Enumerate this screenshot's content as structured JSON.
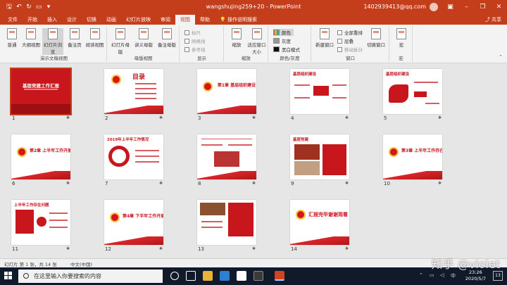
{
  "titlebar": {
    "autosave_icon": "autosave-icon",
    "document_title": "wangshujing259+20 - PowerPoint",
    "user": "1402939413@qq.com",
    "win_minimize": "–",
    "win_restore": "❐",
    "win_close": "✕"
  },
  "tabs": [
    "文件",
    "开始",
    "插入",
    "设计",
    "切换",
    "动画",
    "幻灯片放映",
    "审阅",
    "视图",
    "帮助",
    "操作说明搜索"
  ],
  "active_tab": "视图",
  "share_label": "共享",
  "ribbon": {
    "presentation_views": {
      "label": "演示文稿视图",
      "buttons": [
        "普通",
        "大纲视图",
        "幻灯片浏览",
        "备注页",
        "阅读视图"
      ]
    },
    "master_views": {
      "label": "母版视图",
      "buttons": [
        "幻灯片母版",
        "讲义母版",
        "备注母版"
      ]
    },
    "show": {
      "label": "显示",
      "items": [
        "标尺",
        "网格线",
        "参考线"
      ]
    },
    "zoom": {
      "label": "缩放",
      "buttons": [
        "缩放",
        "适应窗口大小"
      ]
    },
    "color": {
      "label": "颜色/灰度",
      "items": [
        "颜色",
        "灰度",
        "黑白模式"
      ]
    },
    "window": {
      "label": "窗口",
      "buttons": [
        "新建窗口"
      ],
      "items": [
        "全部重排",
        "层叠",
        "移动拆分"
      ],
      "switch": "切换窗口"
    },
    "macros": {
      "label": "宏",
      "buttons": [
        "宏"
      ]
    }
  },
  "slides": [
    {
      "num": "1",
      "title": "基层党建工作汇报"
    },
    {
      "num": "2",
      "title": "目录"
    },
    {
      "num": "3",
      "title": "第1章 基层组织建设"
    },
    {
      "num": "4",
      "title": "基层组织建设"
    },
    {
      "num": "5",
      "title": "基层组织建设"
    },
    {
      "num": "6",
      "title": "第2章 上半年工作开展情况"
    },
    {
      "num": "7",
      "title": "2019年上半年工作情况"
    },
    {
      "num": "8",
      "title": ""
    },
    {
      "num": "9",
      "title": "基层党建"
    },
    {
      "num": "10",
      "title": "第3章 上半年工作存在问题"
    },
    {
      "num": "11",
      "title": "上半年工作存在问题"
    },
    {
      "num": "12",
      "title": "第4章 下半年工作开展计划"
    },
    {
      "num": "13",
      "title": ""
    },
    {
      "num": "14",
      "title": "汇报完毕谢谢观看"
    }
  ],
  "status": {
    "slide_info": "幻灯片 第 1 张，共 14 张",
    "language": "中文(中国)"
  },
  "taskbar": {
    "search_placeholder": "在这里输入你要搜索的内容",
    "time": "23:26",
    "date": "2020/5/7",
    "tray_lang": "中",
    "notifications": "13"
  },
  "watermark": "知乎 @violet",
  "colors": {
    "accent": "#c43e1c",
    "slide_red": "#c8161d"
  }
}
